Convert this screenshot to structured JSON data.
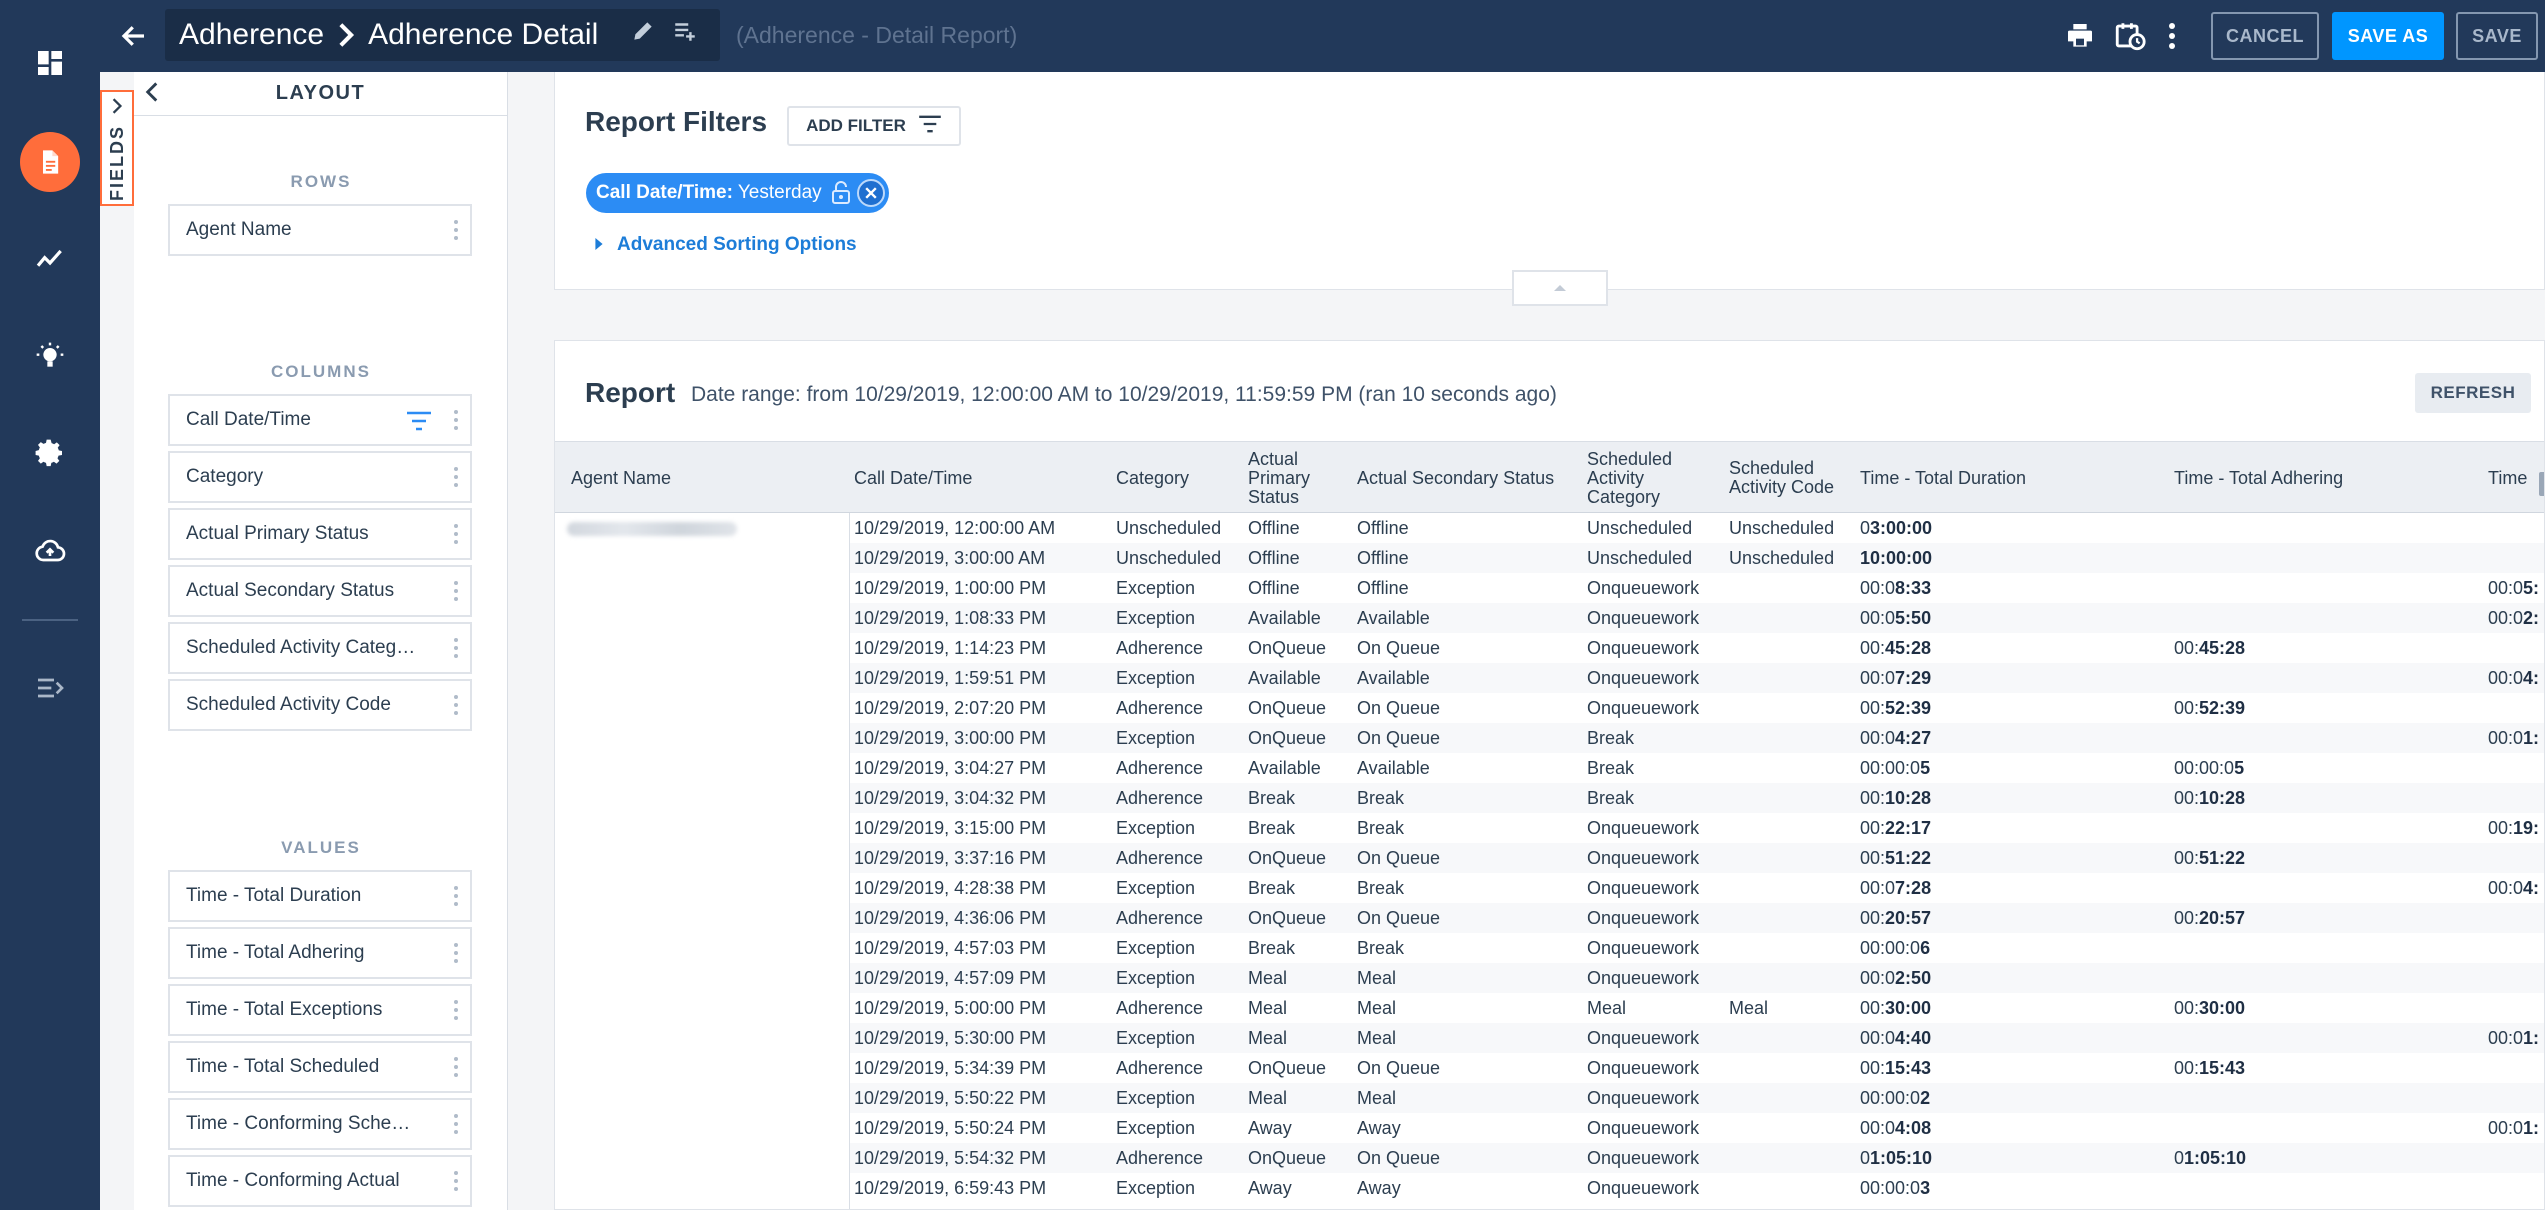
{
  "header": {
    "breadcrumb": [
      "Adherence",
      "Adherence Detail"
    ],
    "subtitle": "(Adherence - Detail Report)",
    "buttons": {
      "cancel": "CANCEL",
      "save_as": "SAVE AS",
      "save": "SAVE"
    }
  },
  "fields_tab": {
    "label": "FIELDS"
  },
  "layout_panel": {
    "title": "LAYOUT",
    "rows_label": "ROWS",
    "rows": [
      "Agent Name"
    ],
    "columns_label": "COLUMNS",
    "columns": [
      "Call Date/Time",
      "Category",
      "Actual Primary Status",
      "Actual Secondary Status",
      "Scheduled Activity Category",
      "Scheduled Activity Code"
    ],
    "values_label": "VALUES",
    "values": [
      "Time - Total Duration",
      "Time - Total Adhering",
      "Time - Total Exceptions",
      "Time - Total Scheduled",
      "Time - Conforming Schedul...",
      "Time - Conforming Actual"
    ]
  },
  "filters": {
    "title": "Report Filters",
    "add_filter": "ADD FILTER",
    "chip_field": "Call Date/Time:",
    "chip_value": " Yesterday",
    "advanced_sorting": "Advanced Sorting Options"
  },
  "report": {
    "title": "Report",
    "date_range": "Date range: from 10/29/2019, 12:00:00 AM to 10/29/2019, 11:59:59 PM (ran 10 seconds ago)",
    "refresh": "REFRESH",
    "columns": [
      "Agent Name",
      "Call Date/Time",
      "Category",
      "Actual Primary Status",
      "Actual Secondary Status",
      "Scheduled Activity Category",
      "Scheduled Activity Code",
      "Time - Total Duration",
      "Time - Total Adhering",
      "Time"
    ],
    "rows": [
      {
        "dt": "10/29/2019, 12:00:00 AM",
        "cat": "Unscheduled",
        "ps": "Offline",
        "ss": "Offline",
        "sac": "Unscheduled",
        "sacode": "Unscheduled",
        "dur": [
          "0",
          "3:00:00"
        ],
        "adh": [
          "",
          ""
        ],
        "ext": [
          "",
          ""
        ]
      },
      {
        "dt": "10/29/2019, 3:00:00 AM",
        "cat": "Unscheduled",
        "ps": "Offline",
        "ss": "Offline",
        "sac": "Unscheduled",
        "sacode": "Unscheduled",
        "dur": [
          "",
          "10:00:00"
        ],
        "adh": [
          "",
          ""
        ],
        "ext": [
          "",
          ""
        ]
      },
      {
        "dt": "10/29/2019, 1:00:00 PM",
        "cat": "Exception",
        "ps": "Offline",
        "ss": "Offline",
        "sac": "Onqueuework",
        "sacode": "",
        "dur": [
          "00:0",
          "8:33"
        ],
        "adh": [
          "",
          ""
        ],
        "ext": [
          "00:0",
          "5:"
        ]
      },
      {
        "dt": "10/29/2019, 1:08:33 PM",
        "cat": "Exception",
        "ps": "Available",
        "ss": "Available",
        "sac": "Onqueuework",
        "sacode": "",
        "dur": [
          "00:0",
          "5:50"
        ],
        "adh": [
          "",
          ""
        ],
        "ext": [
          "00:0",
          "2:"
        ]
      },
      {
        "dt": "10/29/2019, 1:14:23 PM",
        "cat": "Adherence",
        "ps": "OnQueue",
        "ss": "On Queue",
        "sac": "Onqueuework",
        "sacode": "",
        "dur": [
          "00:",
          "45:28"
        ],
        "adh": [
          "00:",
          "45:28"
        ],
        "ext": [
          "",
          ""
        ]
      },
      {
        "dt": "10/29/2019, 1:59:51 PM",
        "cat": "Exception",
        "ps": "Available",
        "ss": "Available",
        "sac": "Onqueuework",
        "sacode": "",
        "dur": [
          "00:0",
          "7:29"
        ],
        "adh": [
          "",
          ""
        ],
        "ext": [
          "00:0",
          "4:"
        ]
      },
      {
        "dt": "10/29/2019, 2:07:20 PM",
        "cat": "Adherence",
        "ps": "OnQueue",
        "ss": "On Queue",
        "sac": "Onqueuework",
        "sacode": "",
        "dur": [
          "00:",
          "52:39"
        ],
        "adh": [
          "00:",
          "52:39"
        ],
        "ext": [
          "",
          ""
        ]
      },
      {
        "dt": "10/29/2019, 3:00:00 PM",
        "cat": "Exception",
        "ps": "OnQueue",
        "ss": "On Queue",
        "sac": "Break",
        "sacode": "",
        "dur": [
          "00:0",
          "4:27"
        ],
        "adh": [
          "",
          ""
        ],
        "ext": [
          "00:0",
          "1:"
        ]
      },
      {
        "dt": "10/29/2019, 3:04:27 PM",
        "cat": "Adherence",
        "ps": "Available",
        "ss": "Available",
        "sac": "Break",
        "sacode": "",
        "dur": [
          "00:00:0",
          "5"
        ],
        "adh": [
          "00:00:0",
          "5"
        ],
        "ext": [
          "",
          ""
        ]
      },
      {
        "dt": "10/29/2019, 3:04:32 PM",
        "cat": "Adherence",
        "ps": "Break",
        "ss": "Break",
        "sac": "Break",
        "sacode": "",
        "dur": [
          "00:",
          "10:28"
        ],
        "adh": [
          "00:",
          "10:28"
        ],
        "ext": [
          "",
          ""
        ]
      },
      {
        "dt": "10/29/2019, 3:15:00 PM",
        "cat": "Exception",
        "ps": "Break",
        "ss": "Break",
        "sac": "Onqueuework",
        "sacode": "",
        "dur": [
          "00:",
          "22:17"
        ],
        "adh": [
          "",
          ""
        ],
        "ext": [
          "00:",
          "19:"
        ]
      },
      {
        "dt": "10/29/2019, 3:37:16 PM",
        "cat": "Adherence",
        "ps": "OnQueue",
        "ss": "On Queue",
        "sac": "Onqueuework",
        "sacode": "",
        "dur": [
          "00:",
          "51:22"
        ],
        "adh": [
          "00:",
          "51:22"
        ],
        "ext": [
          "",
          ""
        ]
      },
      {
        "dt": "10/29/2019, 4:28:38 PM",
        "cat": "Exception",
        "ps": "Break",
        "ss": "Break",
        "sac": "Onqueuework",
        "sacode": "",
        "dur": [
          "00:0",
          "7:28"
        ],
        "adh": [
          "",
          ""
        ],
        "ext": [
          "00:0",
          "4:"
        ]
      },
      {
        "dt": "10/29/2019, 4:36:06 PM",
        "cat": "Adherence",
        "ps": "OnQueue",
        "ss": "On Queue",
        "sac": "Onqueuework",
        "sacode": "",
        "dur": [
          "00:",
          "20:57"
        ],
        "adh": [
          "00:",
          "20:57"
        ],
        "ext": [
          "",
          ""
        ]
      },
      {
        "dt": "10/29/2019, 4:57:03 PM",
        "cat": "Exception",
        "ps": "Break",
        "ss": "Break",
        "sac": "Onqueuework",
        "sacode": "",
        "dur": [
          "00:00:0",
          "6"
        ],
        "adh": [
          "",
          ""
        ],
        "ext": [
          "",
          ""
        ]
      },
      {
        "dt": "10/29/2019, 4:57:09 PM",
        "cat": "Exception",
        "ps": "Meal",
        "ss": "Meal",
        "sac": "Onqueuework",
        "sacode": "",
        "dur": [
          "00:0",
          "2:50"
        ],
        "adh": [
          "",
          ""
        ],
        "ext": [
          "",
          ""
        ]
      },
      {
        "dt": "10/29/2019, 5:00:00 PM",
        "cat": "Adherence",
        "ps": "Meal",
        "ss": "Meal",
        "sac": "Meal",
        "sacode": "Meal",
        "dur": [
          "00:",
          "30:00"
        ],
        "adh": [
          "00:",
          "30:00"
        ],
        "ext": [
          "",
          ""
        ]
      },
      {
        "dt": "10/29/2019, 5:30:00 PM",
        "cat": "Exception",
        "ps": "Meal",
        "ss": "Meal",
        "sac": "Onqueuework",
        "sacode": "",
        "dur": [
          "00:0",
          "4:40"
        ],
        "adh": [
          "",
          ""
        ],
        "ext": [
          "00:0",
          "1:"
        ]
      },
      {
        "dt": "10/29/2019, 5:34:39 PM",
        "cat": "Adherence",
        "ps": "OnQueue",
        "ss": "On Queue",
        "sac": "Onqueuework",
        "sacode": "",
        "dur": [
          "00:",
          "15:43"
        ],
        "adh": [
          "00:",
          "15:43"
        ],
        "ext": [
          "",
          ""
        ]
      },
      {
        "dt": "10/29/2019, 5:50:22 PM",
        "cat": "Exception",
        "ps": "Meal",
        "ss": "Meal",
        "sac": "Onqueuework",
        "sacode": "",
        "dur": [
          "00:00:0",
          "2"
        ],
        "adh": [
          "",
          ""
        ],
        "ext": [
          "",
          ""
        ]
      },
      {
        "dt": "10/29/2019, 5:50:24 PM",
        "cat": "Exception",
        "ps": "Away",
        "ss": "Away",
        "sac": "Onqueuework",
        "sacode": "",
        "dur": [
          "00:0",
          "4:08"
        ],
        "adh": [
          "",
          ""
        ],
        "ext": [
          "00:0",
          "1:"
        ]
      },
      {
        "dt": "10/29/2019, 5:54:32 PM",
        "cat": "Adherence",
        "ps": "OnQueue",
        "ss": "On Queue",
        "sac": "Onqueuework",
        "sacode": "",
        "dur": [
          "0",
          "1:05:10"
        ],
        "adh": [
          "0",
          "1:05:10"
        ],
        "ext": [
          "",
          ""
        ]
      },
      {
        "dt": "10/29/2019, 6:59:43 PM",
        "cat": "Exception",
        "ps": "Away",
        "ss": "Away",
        "sac": "Onqueuework",
        "sacode": "",
        "dur": [
          "00:00:0",
          "3"
        ],
        "adh": [
          "",
          ""
        ],
        "ext": [
          "",
          ""
        ]
      }
    ]
  },
  "colors": {
    "nav": "#22395a",
    "accent": "#ff6d3b",
    "primary": "#0096ff",
    "chip": "#2c8cf4",
    "link": "#1d7dd8"
  },
  "icons": {
    "rail": [
      "dashboard-icon",
      "report-icon",
      "analytics-icon",
      "insights-icon",
      "settings-icon",
      "cloud-upload-icon",
      "expand-menu-icon"
    ]
  }
}
